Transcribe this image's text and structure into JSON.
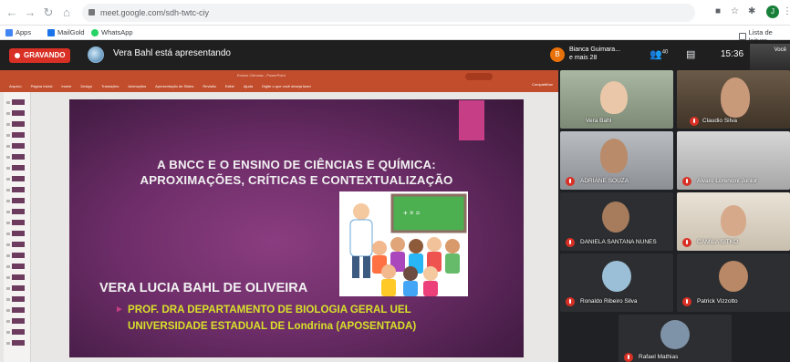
{
  "browser": {
    "url": "meet.google.com/sdh-twtc-ciy",
    "bookmarks": [
      "Apps",
      "MailGold",
      "WhatsApp"
    ],
    "reading_list": "Lista de leitura",
    "profile_initial": "J"
  },
  "meet": {
    "recording_label": "GRAVANDO",
    "presenting_text": "Vera Bahl está apresentando",
    "participant_summary_name": "Bianca Guimara...",
    "participant_summary_more": "e mais 28",
    "participant_summary_initial": "B",
    "participants_count": "40",
    "time": "15:36",
    "self_label": "Você"
  },
  "presentation": {
    "app_title": "Ensino Ciências - PowerPoint",
    "menu": [
      "Arquivo",
      "Página Inicial",
      "Inserir",
      "Design",
      "Transições",
      "Animações",
      "Apresentação de Slides",
      "Revisão",
      "Exibir",
      "Ajuda",
      "Digite o que você deseja fazer"
    ],
    "share_label": "Compartilhar",
    "slide_title_line1": "A BNCC E O ENSINO DE CIÊNCIAS E QUÍMICA:",
    "slide_title_line2": "APROXIMAÇÕES, CRÍTICAS E CONTEXTUALIZAÇÃO",
    "author": "VERA LUCIA BAHL DE OLIVEIRA",
    "affiliation_line1": "PROF. DRA DEPARTAMENTO DE BIOLOGIA GERAL UEL",
    "affiliation_line2": "UNIVERSIDADE ESTADUAL DE Londrina (APOSENTADA)"
  },
  "participants": [
    {
      "name": "Vera Bahl"
    },
    {
      "name": "Claudio Silva"
    },
    {
      "name": "ADRIANE SOUZA"
    },
    {
      "name": "Alvaro Lorencini Junior"
    },
    {
      "name": "DANIELA SANTANA NUNES"
    },
    {
      "name": "CAMILA SITKO"
    },
    {
      "name": "Ronaldo Ribeiro Silva"
    },
    {
      "name": "Patrick Vizzotto"
    },
    {
      "name": "Rafael Mathias"
    }
  ],
  "colors": {
    "record_red": "#d93025",
    "slide_purple": "#6d2d68",
    "slide_yellow": "#d7e02a",
    "ppt_orange": "#c24d2c"
  }
}
